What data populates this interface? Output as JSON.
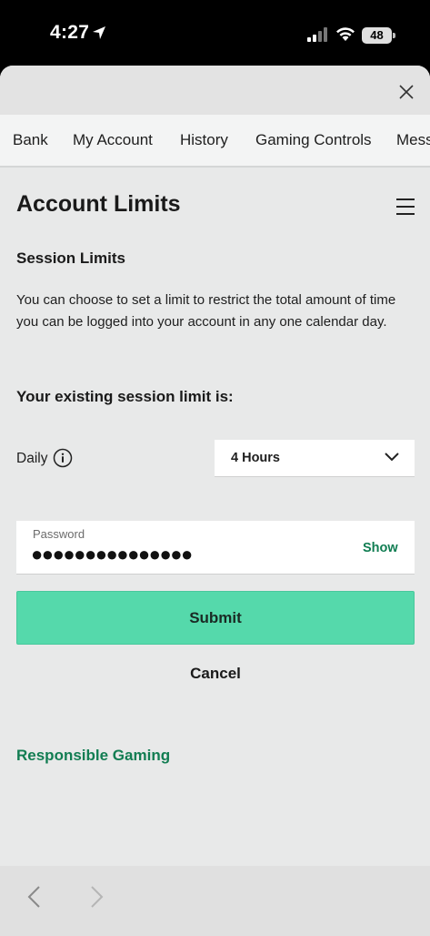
{
  "status_bar": {
    "time": "4:27",
    "battery": "48"
  },
  "tabs": [
    {
      "label": "Bank"
    },
    {
      "label": "My Account"
    },
    {
      "label": "History"
    },
    {
      "label": "Gaming Controls",
      "active": true
    },
    {
      "label": "Mess"
    }
  ],
  "page": {
    "title": "Account Limits",
    "section_title": "Session Limits",
    "description": "You can choose to set a limit to restrict the total amount of time you can be logged into your account in any one calendar day.",
    "existing_label": "Your existing session limit is:",
    "daily_label": "Daily",
    "daily_select_value": "4 Hours"
  },
  "password": {
    "label": "Password",
    "value": "●●●●●●●●●●●●●●●",
    "show_label": "Show"
  },
  "actions": {
    "submit_label": "Submit",
    "cancel_label": "Cancel"
  },
  "links": {
    "responsible_gaming": "Responsible Gaming"
  },
  "colors": {
    "accent": "#55d9ab",
    "link": "#127d52",
    "tab_underline": "#38c99a"
  },
  "icons": [
    "location-arrow-icon",
    "cellular-signal-icon",
    "wifi-icon",
    "battery-icon",
    "close-icon",
    "hamburger-menu-icon",
    "info-icon",
    "chevron-down-icon",
    "back-arrow-icon",
    "forward-arrow-icon"
  ]
}
